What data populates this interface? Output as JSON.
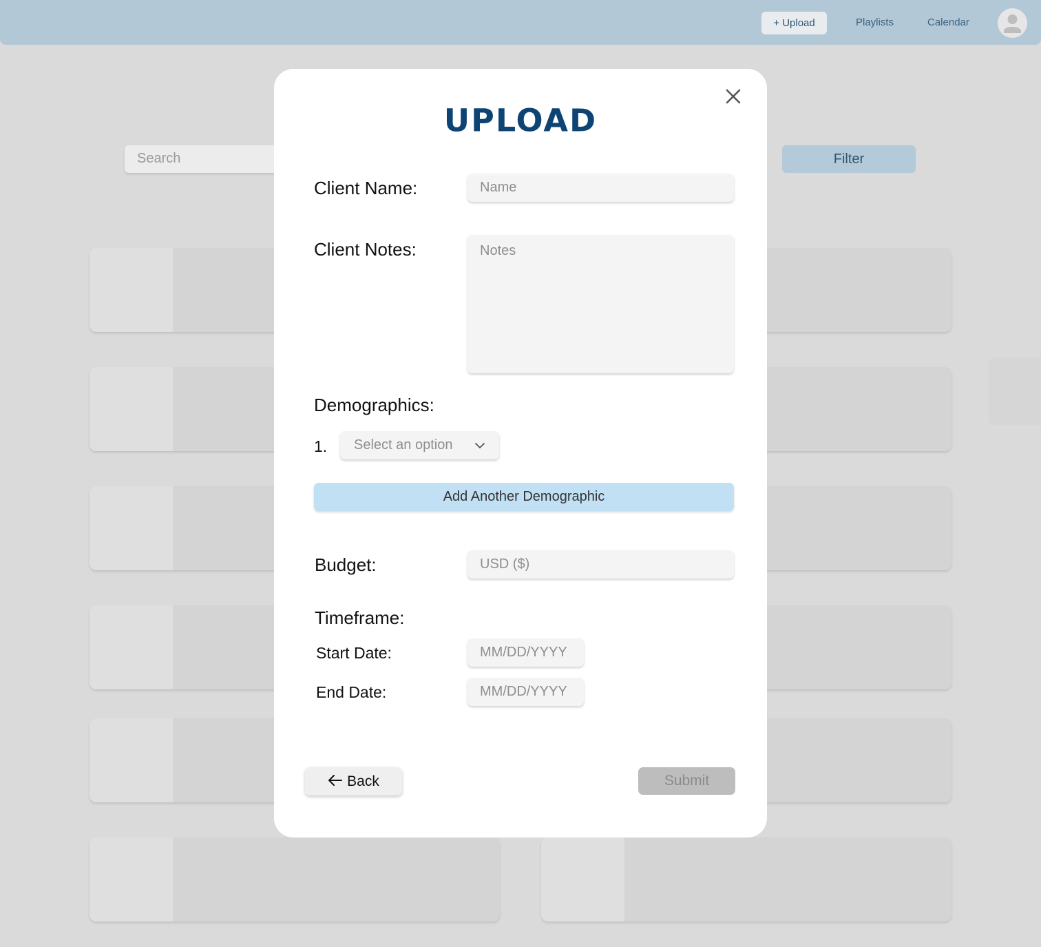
{
  "nav": {
    "upload_label": "+ Upload",
    "playlists_label": "Playlists",
    "calendar_label": "Calendar"
  },
  "background": {
    "search_placeholder": "Search",
    "filter_label": "Filter"
  },
  "modal": {
    "title": "UPLOAD",
    "client_name_label": "Client Name:",
    "client_name_placeholder": "Name",
    "client_notes_label": "Client Notes:",
    "client_notes_placeholder": "Notes",
    "demographics_label": "Demographics:",
    "demographic_index": "1.",
    "demographic_select_value": "Select an option",
    "add_demographic_label": "Add Another Demographic",
    "budget_label": "Budget:",
    "budget_placeholder": "USD ($)",
    "timeframe_label": "Timeframe:",
    "start_date_label": "Start Date:",
    "start_date_placeholder": "MM/DD/YYYY",
    "end_date_label": "End Date:",
    "end_date_placeholder": "MM/DD/YYYY",
    "back_label": "Back",
    "submit_label": "Submit"
  },
  "colors": {
    "accent": "#0e4474",
    "navbar": "#b3c8d6",
    "add_button": "#c1e0f3",
    "submit_disabled": "#bdbdbd"
  },
  "icons": {
    "close": "close-icon",
    "chevron": "chevron-down-icon",
    "back": "arrow-left-icon",
    "avatar": "user-avatar-icon"
  }
}
